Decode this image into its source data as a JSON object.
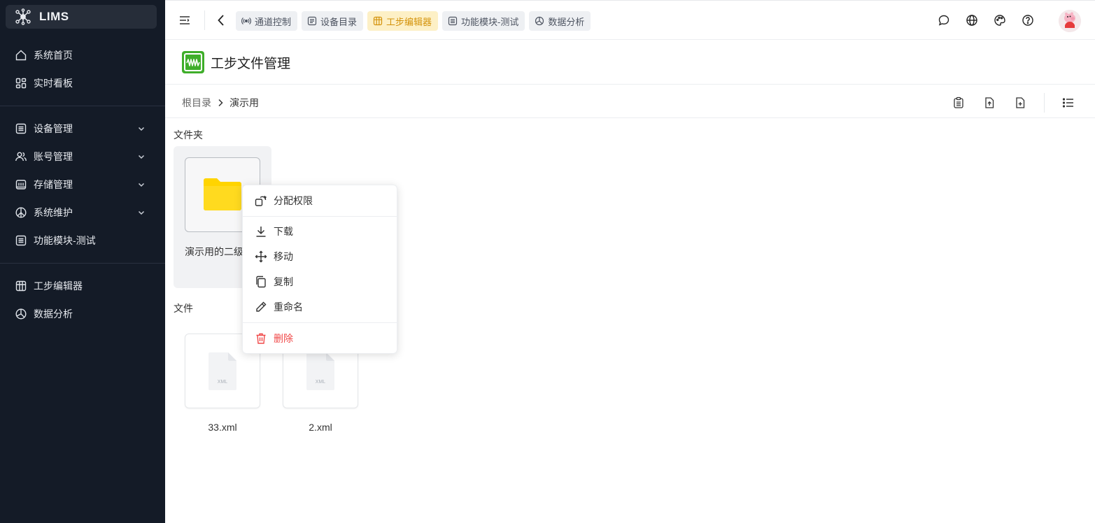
{
  "app": {
    "name": "LIMS"
  },
  "sidebar": {
    "items": [
      {
        "label": "系统首页"
      },
      {
        "label": "实时看板"
      },
      {
        "label": "设备管理"
      },
      {
        "label": "账号管理"
      },
      {
        "label": "存储管理"
      },
      {
        "label": "系统维护"
      },
      {
        "label": "功能模块-测试"
      },
      {
        "label": "工步编辑器"
      },
      {
        "label": "数据分析"
      }
    ]
  },
  "topbar": {
    "tabs": [
      {
        "label": "通道控制",
        "icon": "broadcast-icon"
      },
      {
        "label": "设备目录",
        "icon": "list-doc-icon"
      },
      {
        "label": "工步编辑器",
        "icon": "grid-icon",
        "active": true
      },
      {
        "label": "功能模块-测试",
        "icon": "list-doc-icon"
      },
      {
        "label": "数据分析",
        "icon": "pie-icon"
      }
    ],
    "actions": [
      "message-icon",
      "globe-icon",
      "palette-icon",
      "help-icon"
    ]
  },
  "page": {
    "title": "工步文件管理"
  },
  "breadcrumb": {
    "root": "根目录",
    "current": "演示用"
  },
  "content": {
    "folders_label": "文件夹",
    "files_label": "文件",
    "folders": [
      {
        "name": "演示用的二级"
      }
    ],
    "files": [
      {
        "name": "33.xml",
        "type_label": "XML"
      },
      {
        "name": "2.xml",
        "type_label": "XML"
      }
    ]
  },
  "context_menu": {
    "items": [
      {
        "label": "分配权限",
        "icon": "permission-icon"
      },
      {
        "label": "下载",
        "icon": "download-icon"
      },
      {
        "label": "移动",
        "icon": "move-icon"
      },
      {
        "label": "复制",
        "icon": "copy-icon"
      },
      {
        "label": "重命名",
        "icon": "pencil-icon"
      },
      {
        "label": "删除",
        "icon": "trash-icon",
        "danger": true
      }
    ]
  },
  "colors": {
    "sidebar_bg": "#141b27",
    "active_tab_bg": "#fdf0c6",
    "active_tab_text": "#d4930b",
    "danger": "#f04848",
    "folder": "#ffd400",
    "title_icon": "#3fae2a"
  }
}
